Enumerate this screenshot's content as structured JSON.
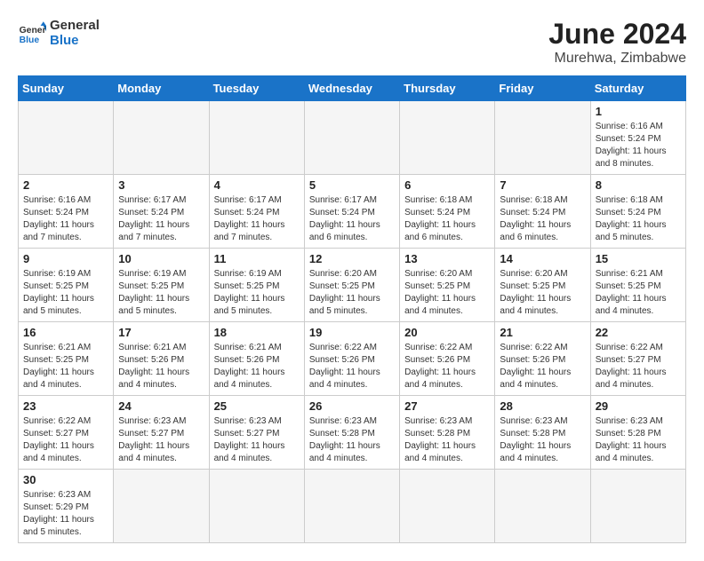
{
  "header": {
    "logo_general": "General",
    "logo_blue": "Blue",
    "title": "June 2024",
    "subtitle": "Murehwa, Zimbabwe"
  },
  "weekdays": [
    "Sunday",
    "Monday",
    "Tuesday",
    "Wednesday",
    "Thursday",
    "Friday",
    "Saturday"
  ],
  "days": [
    {
      "num": "",
      "info": ""
    },
    {
      "num": "",
      "info": ""
    },
    {
      "num": "",
      "info": ""
    },
    {
      "num": "",
      "info": ""
    },
    {
      "num": "",
      "info": ""
    },
    {
      "num": "",
      "info": ""
    },
    {
      "num": "1",
      "info": "Sunrise: 6:16 AM\nSunset: 5:24 PM\nDaylight: 11 hours and 8 minutes."
    },
    {
      "num": "2",
      "info": "Sunrise: 6:16 AM\nSunset: 5:24 PM\nDaylight: 11 hours and 7 minutes."
    },
    {
      "num": "3",
      "info": "Sunrise: 6:17 AM\nSunset: 5:24 PM\nDaylight: 11 hours and 7 minutes."
    },
    {
      "num": "4",
      "info": "Sunrise: 6:17 AM\nSunset: 5:24 PM\nDaylight: 11 hours and 7 minutes."
    },
    {
      "num": "5",
      "info": "Sunrise: 6:17 AM\nSunset: 5:24 PM\nDaylight: 11 hours and 6 minutes."
    },
    {
      "num": "6",
      "info": "Sunrise: 6:18 AM\nSunset: 5:24 PM\nDaylight: 11 hours and 6 minutes."
    },
    {
      "num": "7",
      "info": "Sunrise: 6:18 AM\nSunset: 5:24 PM\nDaylight: 11 hours and 6 minutes."
    },
    {
      "num": "8",
      "info": "Sunrise: 6:18 AM\nSunset: 5:24 PM\nDaylight: 11 hours and 5 minutes."
    },
    {
      "num": "9",
      "info": "Sunrise: 6:19 AM\nSunset: 5:25 PM\nDaylight: 11 hours and 5 minutes."
    },
    {
      "num": "10",
      "info": "Sunrise: 6:19 AM\nSunset: 5:25 PM\nDaylight: 11 hours and 5 minutes."
    },
    {
      "num": "11",
      "info": "Sunrise: 6:19 AM\nSunset: 5:25 PM\nDaylight: 11 hours and 5 minutes."
    },
    {
      "num": "12",
      "info": "Sunrise: 6:20 AM\nSunset: 5:25 PM\nDaylight: 11 hours and 5 minutes."
    },
    {
      "num": "13",
      "info": "Sunrise: 6:20 AM\nSunset: 5:25 PM\nDaylight: 11 hours and 4 minutes."
    },
    {
      "num": "14",
      "info": "Sunrise: 6:20 AM\nSunset: 5:25 PM\nDaylight: 11 hours and 4 minutes."
    },
    {
      "num": "15",
      "info": "Sunrise: 6:21 AM\nSunset: 5:25 PM\nDaylight: 11 hours and 4 minutes."
    },
    {
      "num": "16",
      "info": "Sunrise: 6:21 AM\nSunset: 5:25 PM\nDaylight: 11 hours and 4 minutes."
    },
    {
      "num": "17",
      "info": "Sunrise: 6:21 AM\nSunset: 5:26 PM\nDaylight: 11 hours and 4 minutes."
    },
    {
      "num": "18",
      "info": "Sunrise: 6:21 AM\nSunset: 5:26 PM\nDaylight: 11 hours and 4 minutes."
    },
    {
      "num": "19",
      "info": "Sunrise: 6:22 AM\nSunset: 5:26 PM\nDaylight: 11 hours and 4 minutes."
    },
    {
      "num": "20",
      "info": "Sunrise: 6:22 AM\nSunset: 5:26 PM\nDaylight: 11 hours and 4 minutes."
    },
    {
      "num": "21",
      "info": "Sunrise: 6:22 AM\nSunset: 5:26 PM\nDaylight: 11 hours and 4 minutes."
    },
    {
      "num": "22",
      "info": "Sunrise: 6:22 AM\nSunset: 5:27 PM\nDaylight: 11 hours and 4 minutes."
    },
    {
      "num": "23",
      "info": "Sunrise: 6:22 AM\nSunset: 5:27 PM\nDaylight: 11 hours and 4 minutes."
    },
    {
      "num": "24",
      "info": "Sunrise: 6:23 AM\nSunset: 5:27 PM\nDaylight: 11 hours and 4 minutes."
    },
    {
      "num": "25",
      "info": "Sunrise: 6:23 AM\nSunset: 5:27 PM\nDaylight: 11 hours and 4 minutes."
    },
    {
      "num": "26",
      "info": "Sunrise: 6:23 AM\nSunset: 5:28 PM\nDaylight: 11 hours and 4 minutes."
    },
    {
      "num": "27",
      "info": "Sunrise: 6:23 AM\nSunset: 5:28 PM\nDaylight: 11 hours and 4 minutes."
    },
    {
      "num": "28",
      "info": "Sunrise: 6:23 AM\nSunset: 5:28 PM\nDaylight: 11 hours and 4 minutes."
    },
    {
      "num": "29",
      "info": "Sunrise: 6:23 AM\nSunset: 5:28 PM\nDaylight: 11 hours and 4 minutes."
    },
    {
      "num": "30",
      "info": "Sunrise: 6:23 AM\nSunset: 5:29 PM\nDaylight: 11 hours and 5 minutes."
    },
    {
      "num": "",
      "info": ""
    },
    {
      "num": "",
      "info": ""
    },
    {
      "num": "",
      "info": ""
    },
    {
      "num": "",
      "info": ""
    },
    {
      "num": "",
      "info": ""
    },
    {
      "num": "",
      "info": ""
    }
  ],
  "accent_color": "#1a73c8"
}
